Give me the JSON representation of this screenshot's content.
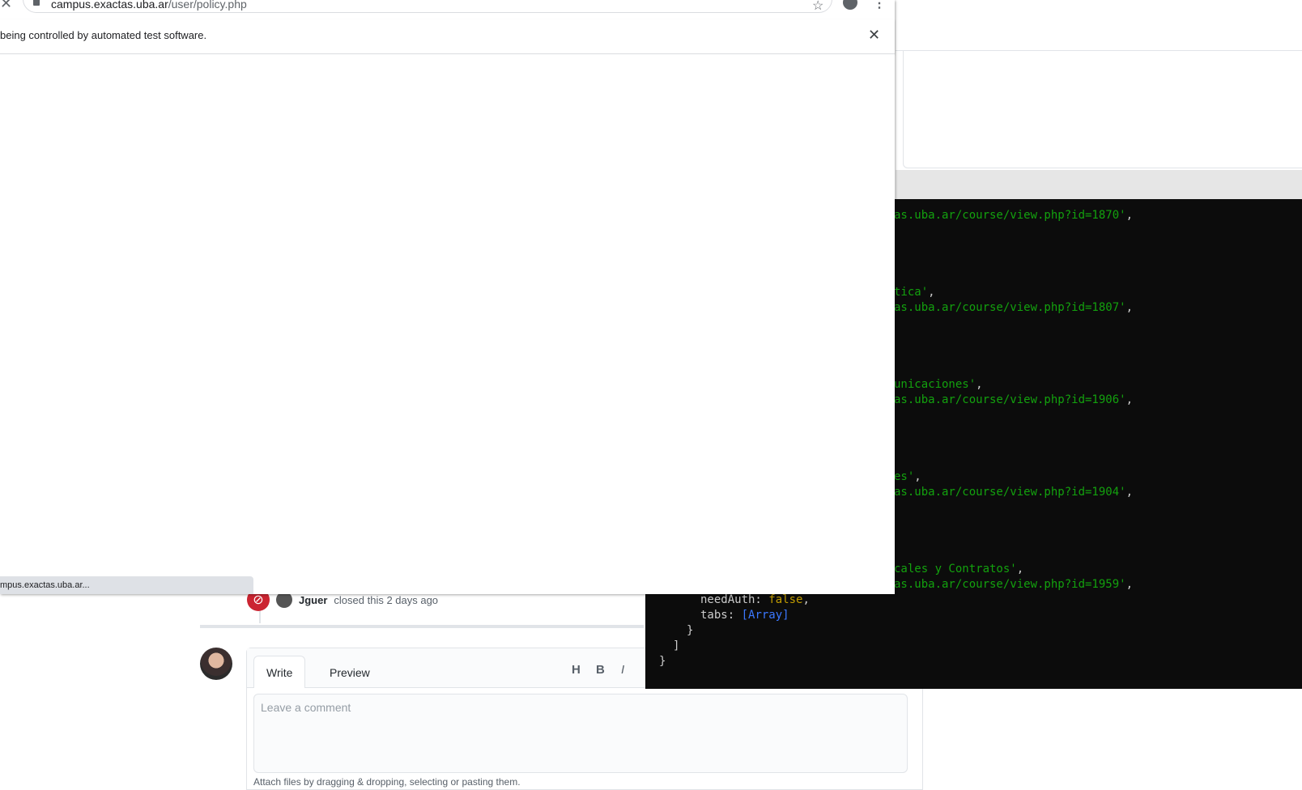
{
  "browser": {
    "url_host": "campus.exactas.uba.ar",
    "url_path": "/user/policy.php",
    "infobar_text": "being controlled by automated test software.",
    "status_url": "mpus.exactas.uba.ar..."
  },
  "terminal": {
    "lines": [
      {
        "text": "as.uba.ar/course/view.php?id=1870'",
        "suffix": ","
      },
      {
        "text": "tica'",
        "suffix": ","
      },
      {
        "text": "as.uba.ar/course/view.php?id=1807'",
        "suffix": ","
      },
      {
        "text": "unicaciones'",
        "suffix": ","
      },
      {
        "text": "as.uba.ar/course/view.php?id=1906'",
        "suffix": ","
      },
      {
        "text": "es'",
        "suffix": ","
      },
      {
        "text": "as.uba.ar/course/view.php?id=1904'",
        "suffix": ","
      },
      {
        "text": "cales y Contratos'",
        "suffix": ","
      },
      {
        "text": "as.uba.ar/course/view.php?id=1959'",
        "suffix": ","
      }
    ],
    "needAuth_key": "needAuth:",
    "needAuth_value": "false",
    "tabs_key": "tabs:",
    "tabs_value": "[Array]",
    "close_brace_1": "}",
    "close_bracket": "]",
    "close_brace_2": "}"
  },
  "issue": {
    "closed_actor": "Jguer",
    "closed_text": "closed this 2 days ago",
    "tab_write": "Write",
    "tab_preview": "Preview",
    "toolbar_heading": "H",
    "toolbar_bold": "B",
    "toolbar_italic": "I",
    "comment_placeholder": "Leave a comment",
    "attach_text": "Attach files by dragging & dropping, selecting or pasting them."
  },
  "colors": {
    "terminal_bg": "#0c0c0c",
    "string_green": "#13a10e",
    "closed_red": "#cb2431"
  }
}
